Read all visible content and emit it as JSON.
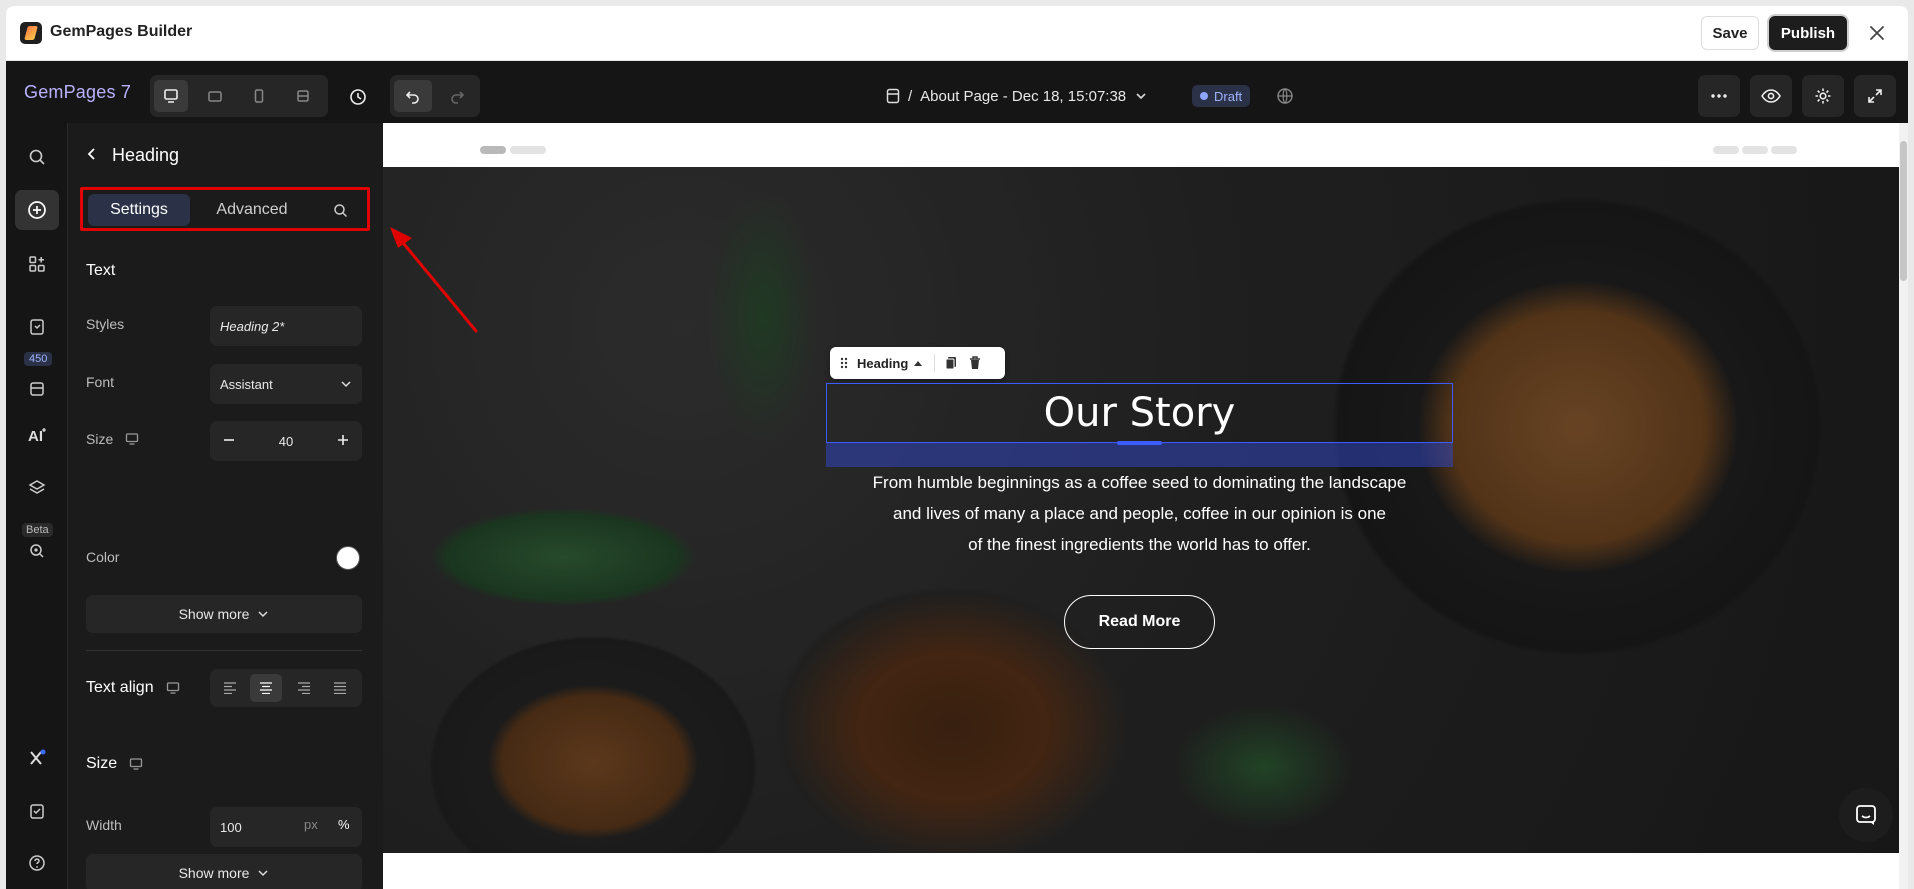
{
  "window": {
    "app_title": "GemPages Builder",
    "save_label": "Save",
    "publish_label": "Publish",
    "close_icon": "close-icon"
  },
  "toolbar": {
    "brand": "GemPages 7",
    "page_crumb_prefix": "/",
    "page_name": "About Page - Dec 18, 15:07:38",
    "status": "Draft",
    "accent": "#b9b2ff"
  },
  "rail": {
    "badge": "450",
    "beta": "Beta"
  },
  "panel": {
    "title": "Heading",
    "tabs": [
      "Settings",
      "Advanced"
    ],
    "text_section": "Text",
    "styles_label": "Styles",
    "styles_value": "Heading 2*",
    "font_label": "Font",
    "font_value": "Assistant",
    "size_label": "Size",
    "size_value": "40",
    "color_label": "Color",
    "show_more": "Show more",
    "text_align_label": "Text align",
    "size_section": "Size",
    "width_label": "Width",
    "width_value": "100",
    "unit_px": "px",
    "unit_pct": "%",
    "highlight_color": "#e00000"
  },
  "canvas": {
    "element_toolbar_label": "Heading",
    "heading": "Our Story",
    "paragraph_lines": [
      "From humble beginnings as a coffee seed to dominating the landscape",
      "and lives of many a place and people, coffee in our opinion is one",
      "of the finest ingredients the world has to offer."
    ],
    "button_label": "Read More",
    "selection_color": "#3d5cff"
  }
}
